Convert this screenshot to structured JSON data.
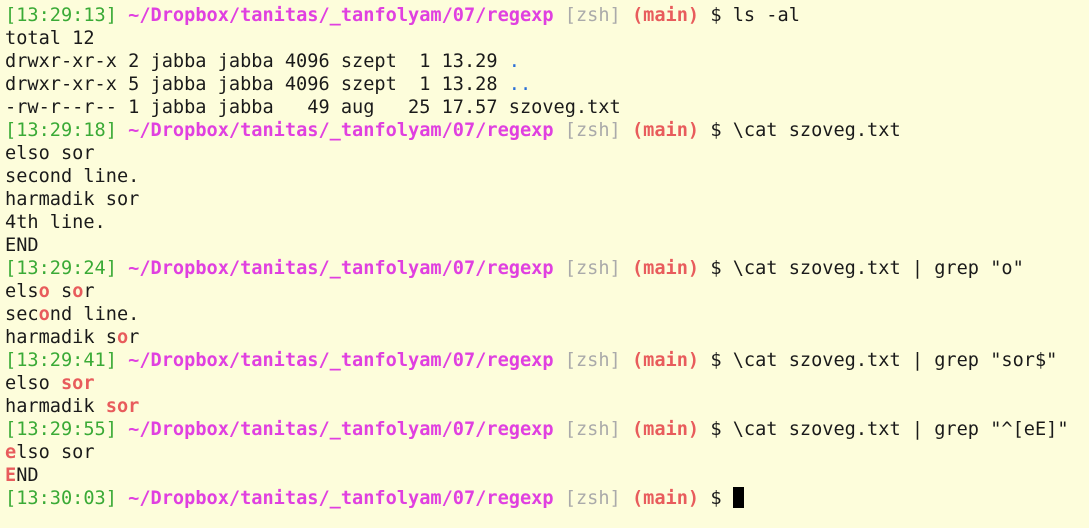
{
  "prompt": {
    "path": "~/Dropbox/tanitas/_tanfolyam/07/regexp",
    "shell": "[zsh]",
    "branch": "(main)",
    "symbol": "$"
  },
  "cmd1": {
    "time": "[13:29:13]",
    "command": "ls -al",
    "total": "total 12",
    "rows": [
      {
        "info": "drwxr-xr-x 2 jabba jabba 4096 szept  1 13.29 ",
        "name": "."
      },
      {
        "info": "drwxr-xr-x 5 jabba jabba 4096 szept  1 13.28 ",
        "name": ".."
      },
      {
        "info": "-rw-r--r-- 1 jabba jabba   49 aug   25 17.57 ",
        "name": "szoveg.txt"
      }
    ]
  },
  "cmd2": {
    "time": "[13:29:18]",
    "command": "\\cat szoveg.txt",
    "out": [
      "elso sor",
      "second line.",
      "harmadik sor",
      "4th line.",
      "END"
    ]
  },
  "cmd3": {
    "time": "[13:29:24]",
    "command": "\\cat szoveg.txt | grep \"o\"",
    "out": [
      {
        "a": "els",
        "m": "o",
        "b": " s",
        "m2": "o",
        "c": "r"
      },
      {
        "a": "sec",
        "m": "o",
        "b": "nd line."
      },
      {
        "a": "harmadik s",
        "m": "o",
        "b": "r"
      }
    ]
  },
  "cmd4": {
    "time": "[13:29:41]",
    "command": "\\cat szoveg.txt | grep \"sor$\"",
    "out": [
      {
        "a": "elso ",
        "m": "sor"
      },
      {
        "a": "harmadik ",
        "m": "sor"
      }
    ]
  },
  "cmd5": {
    "time": "[13:29:55]",
    "command": "\\cat szoveg.txt | grep \"^[eE]\"",
    "out": [
      {
        "m": "e",
        "b": "lso sor"
      },
      {
        "m": "E",
        "b": "ND"
      }
    ]
  },
  "cmd6": {
    "time": "[13:30:03]"
  }
}
